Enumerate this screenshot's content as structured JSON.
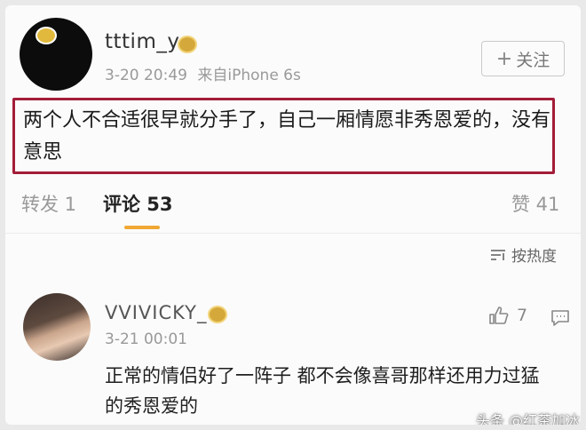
{
  "post": {
    "username": "tttim_y",
    "time": "3-20 20:49",
    "source": "来自iPhone 6s",
    "follow_label": "关注",
    "text": "两个人不合适很早就分手了，自己一厢情愿非秀恩爱的，没有意思"
  },
  "stats": {
    "repost": "转发 1",
    "comments": "评论 53",
    "likes": "赞 41"
  },
  "sort_label": "按热度",
  "comment": {
    "username": "VVIVICKY_",
    "time": "3-21 00:01",
    "likes": "7",
    "text": "正常的情侣好了一阵子 都不会像喜哥那样还用力过猛的秀恩爱的"
  },
  "watermark": "头条 @红茶加冰",
  "colors": {
    "highlight_border": "#a31d38",
    "tab_accent": "#f0a733",
    "vip_badge": "#d4a83a"
  }
}
